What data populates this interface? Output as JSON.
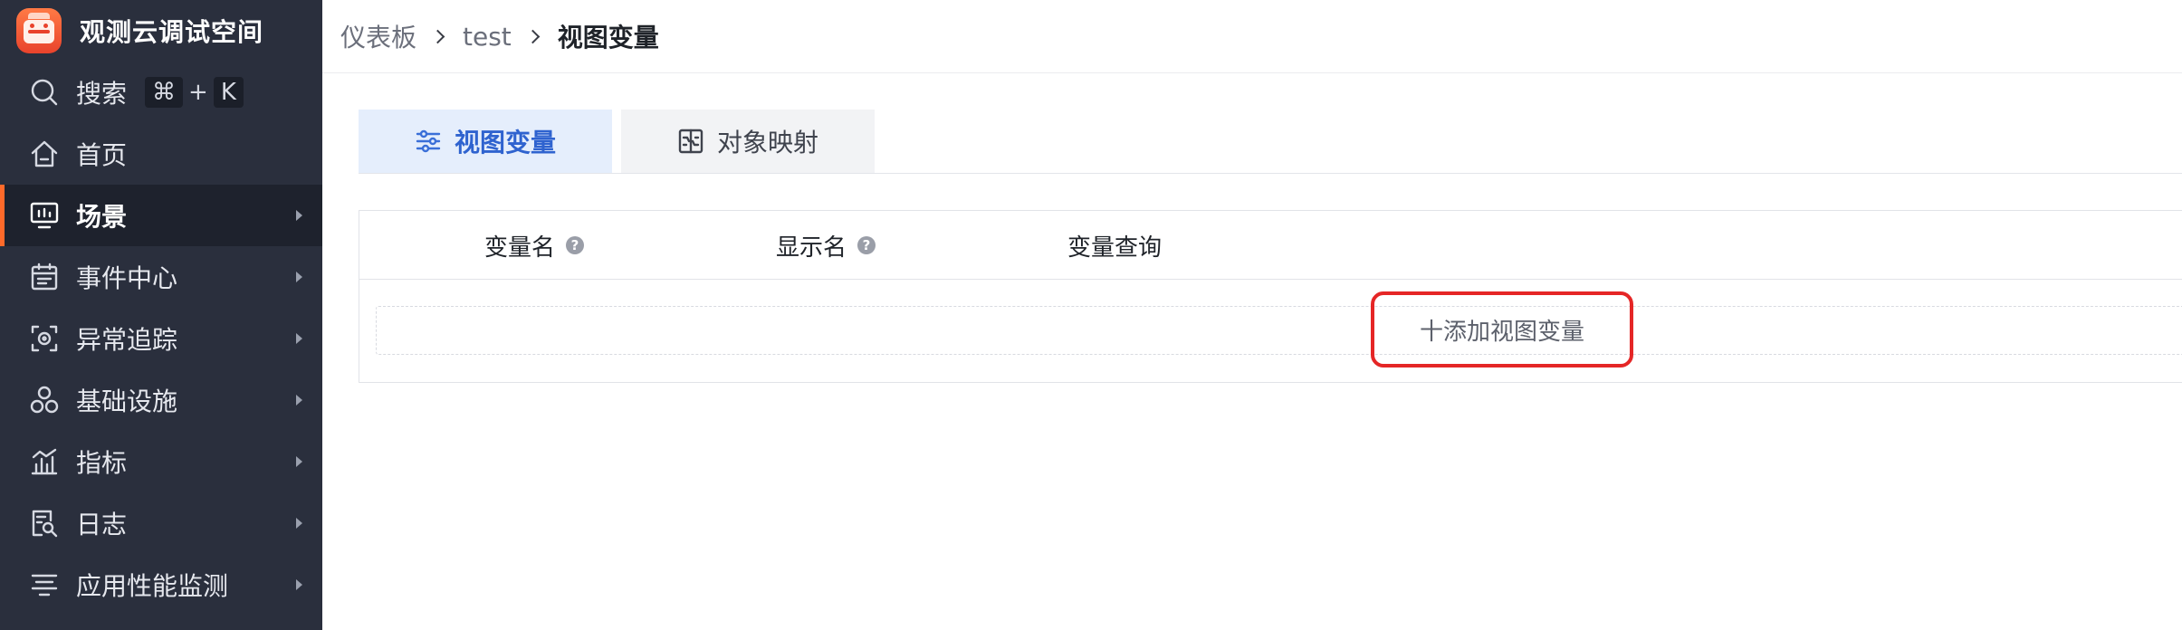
{
  "workspace": {
    "title": "观测云调试空间"
  },
  "sidebar": {
    "search": {
      "label": "搜索",
      "shortcut_cmd": "⌘",
      "shortcut_plus": "+",
      "shortcut_key": "K"
    },
    "items": [
      {
        "label": "首页",
        "icon": "home-icon",
        "has_submenu": false,
        "active": false
      },
      {
        "label": "场景",
        "icon": "dashboard-monitor-icon",
        "has_submenu": true,
        "active": true
      },
      {
        "label": "事件中心",
        "icon": "calendar-icon",
        "has_submenu": true,
        "active": false
      },
      {
        "label": "异常追踪",
        "icon": "target-scan-icon",
        "has_submenu": true,
        "active": false
      },
      {
        "label": "基础设施",
        "icon": "infrastructure-nodes-icon",
        "has_submenu": true,
        "active": false
      },
      {
        "label": "指标",
        "icon": "metrics-chart-icon",
        "has_submenu": true,
        "active": false
      },
      {
        "label": "日志",
        "icon": "log-search-icon",
        "has_submenu": true,
        "active": false
      },
      {
        "label": "应用性能监测",
        "icon": "apm-list-icon",
        "has_submenu": true,
        "active": false
      }
    ]
  },
  "breadcrumb": [
    "仪表板",
    "test",
    "视图变量"
  ],
  "tabs": [
    {
      "label": "视图变量",
      "icon": "sliders-icon",
      "active": true
    },
    {
      "label": "对象映射",
      "icon": "mapping-icon",
      "active": false
    }
  ],
  "table": {
    "columns": [
      {
        "label": "变量名",
        "help": "?"
      },
      {
        "label": "显示名",
        "help": "?"
      },
      {
        "label": "变量查询"
      }
    ],
    "add_button": "十添加视图变量"
  },
  "colors": {
    "sidebar_bg": "#2a2f3d",
    "active_indicator": "#ff6a2a",
    "active_tab_bg": "#e5eefc",
    "active_tab_text": "#2f63cf",
    "highlight_outline": "#e52626"
  }
}
